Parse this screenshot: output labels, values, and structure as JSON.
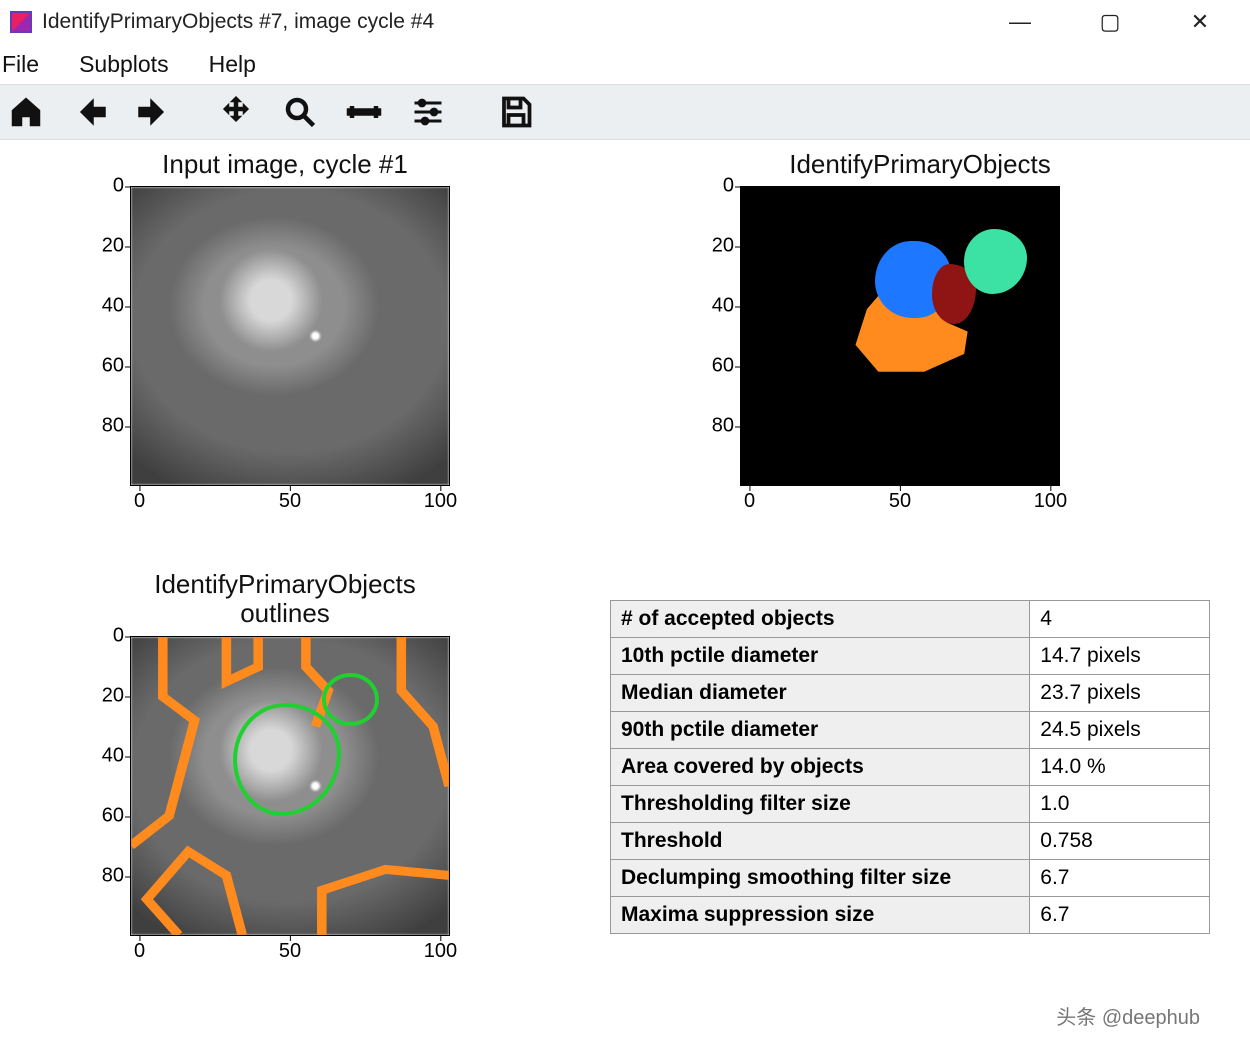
{
  "window": {
    "title": "IdentifyPrimaryObjects #7, image cycle #4"
  },
  "menu": {
    "items": [
      "File",
      "Subplots",
      "Help"
    ]
  },
  "toolbar_icons": [
    "home",
    "back",
    "forward",
    "pan",
    "zoom",
    "axis-config",
    "subplot-config",
    "save"
  ],
  "plots": {
    "top_left": {
      "title": "Input image, cycle #1"
    },
    "top_right": {
      "title": "IdentifyPrimaryObjects"
    },
    "bottom_left": {
      "title_line1": "IdentifyPrimaryObjects",
      "title_line2": "outlines"
    }
  },
  "chart_data": [
    {
      "type": "heatmap",
      "title": "Input image, cycle #1",
      "xlim": [
        0,
        100
      ],
      "ylim": [
        100,
        0
      ],
      "xticks": [
        0,
        50,
        100
      ],
      "yticks": [
        0,
        20,
        40,
        60,
        80
      ],
      "description": "grayscale microscopy input"
    },
    {
      "type": "heatmap",
      "title": "IdentifyPrimaryObjects",
      "xlim": [
        0,
        100
      ],
      "ylim": [
        100,
        0
      ],
      "xticks": [
        0,
        50,
        100
      ],
      "yticks": [
        0,
        20,
        40,
        60,
        80
      ],
      "objects": [
        {
          "color": "#1e78ff",
          "approx_center": [
            50,
            30
          ]
        },
        {
          "color": "#ff8a1e",
          "approx_center": [
            48,
            48
          ]
        },
        {
          "color": "#8f1515",
          "approx_center": [
            63,
            33
          ]
        },
        {
          "color": "#3be2a4",
          "approx_center": [
            80,
            22
          ]
        }
      ]
    },
    {
      "type": "heatmap",
      "title": "IdentifyPrimaryObjects outlines",
      "xlim": [
        0,
        100
      ],
      "ylim": [
        100,
        0
      ],
      "xticks": [
        0,
        50,
        100
      ],
      "yticks": [
        0,
        20,
        40,
        60,
        80
      ],
      "outline_colors": [
        "#ff8a1e",
        "#20d030",
        "#e048e0"
      ]
    }
  ],
  "axis": {
    "yticks": [
      "0",
      "20",
      "40",
      "60",
      "80"
    ],
    "xticks": [
      "0",
      "50",
      "100"
    ]
  },
  "stats": [
    {
      "label": "# of accepted objects",
      "value": "4"
    },
    {
      "label": "10th pctile diameter",
      "value": "14.7 pixels"
    },
    {
      "label": "Median diameter",
      "value": "23.7 pixels"
    },
    {
      "label": "90th pctile diameter",
      "value": "24.5 pixels"
    },
    {
      "label": "Area covered by objects",
      "value": "14.0 %"
    },
    {
      "label": "Thresholding filter size",
      "value": "1.0"
    },
    {
      "label": "Threshold",
      "value": "0.758"
    },
    {
      "label": "Declumping smoothing filter size",
      "value": "6.7"
    },
    {
      "label": "Maxima suppression size",
      "value": "6.7"
    }
  ],
  "watermark": "头条 @deephub"
}
